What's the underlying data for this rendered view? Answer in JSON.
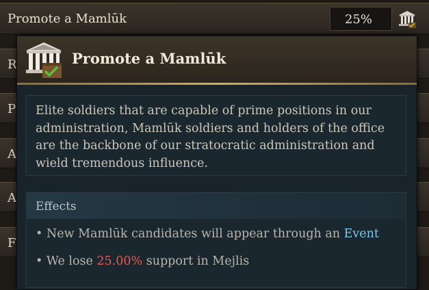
{
  "list": {
    "top_row": {
      "label": "Promote a Mamlūk",
      "value": "25%",
      "icon": "court-building-icon"
    },
    "rows": [
      {
        "label": "R"
      },
      {
        "label": "P"
      },
      {
        "label": "A"
      },
      {
        "label": "A"
      },
      {
        "label": "F"
      }
    ]
  },
  "tooltip": {
    "icon": "court-building-check-icon",
    "title": "Promote a Mamlūk",
    "description": "Elite soldiers that are capable of prime positions in our administration, Mamlūk soldiers and holders of the office are the backbone of our stratocratic administration and wield tremendous influence.",
    "effects": {
      "title": "Effects",
      "items": [
        {
          "bullet": "•",
          "prefix": "New Mamlūk candidates will appear through an ",
          "highlight": "Event",
          "suffix": ""
        },
        {
          "bullet": "•",
          "prefix": "We lose ",
          "highlight": "25.00%",
          "suffix": " support in Mejlis"
        }
      ]
    }
  },
  "colors": {
    "link": "#7cc6ea",
    "negative": "#e35a56",
    "gold_accent": "#d4ad5f"
  }
}
